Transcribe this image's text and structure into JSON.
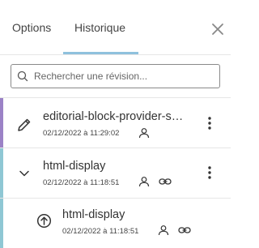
{
  "tabs": [
    {
      "label": "Options",
      "active": false
    },
    {
      "label": "Historique",
      "active": true
    }
  ],
  "icons": {
    "close": "close-icon",
    "search": "search-icon",
    "edit": "pencil-icon",
    "expand": "chevron-down-icon",
    "upload": "arrow-up-circle-icon",
    "user": "user-icon",
    "link": "link-icon",
    "more": "more-vertical-icon"
  },
  "search": {
    "placeholder": "Rechercher une révision..."
  },
  "revisions": [
    {
      "title": "editorial-block-provider-s…",
      "date": "02/12/2022 à 11:29:02",
      "accent_color": "#9b82c6"
    },
    {
      "title": "html-display",
      "date": "02/12/2022 à 11:18:51",
      "accent_color": "#8fc7d4"
    },
    {
      "title": "html-display",
      "date": "02/12/2022 à 11:18:51",
      "accent_color": "#8fc7d4"
    }
  ]
}
